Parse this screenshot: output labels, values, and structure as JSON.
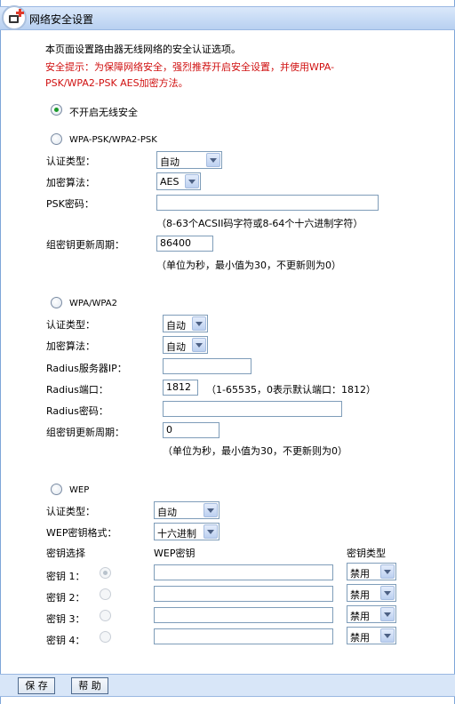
{
  "header": {
    "title": "网络安全设置"
  },
  "intro": "本页面设置路由器无线网络的安全认证选项。",
  "warning": {
    "line1": "安全提示：为保障网络安全，强烈推荐开启安全设置，并使用WPA-",
    "line2": "PSK/WPA2-PSK AES加密方法。"
  },
  "no_security": {
    "label": "不开启无线安全",
    "selected": true
  },
  "wpa_psk": {
    "title": "WPA-PSK/WPA2-PSK",
    "auth_label": "认证类型：",
    "auth_value": "自动",
    "enc_label": "加密算法：",
    "enc_value": "AES",
    "psk_label": "PSK密码：",
    "psk_value": "",
    "psk_hint": "（8-63个ACSII码字符或8-64个十六进制字符）",
    "period_label": "组密钥更新周期：",
    "period_value": "86400",
    "period_hint": "（单位为秒，最小值为30，不更新则为0）"
  },
  "wpa": {
    "title": "WPA/WPA2",
    "auth_label": "认证类型：",
    "auth_value": "自动",
    "enc_label": "加密算法：",
    "enc_value": "自动",
    "radius_ip_label": "Radius服务器IP：",
    "radius_ip_value": "",
    "radius_port_label": "Radius端口：",
    "radius_port_value": "1812",
    "radius_port_hint": "（1-65535，0表示默认端口：1812）",
    "radius_pwd_label": "Radius密码：",
    "radius_pwd_value": "",
    "period_label": "组密钥更新周期：",
    "period_value": "0",
    "period_hint": "（单位为秒，最小值为30，不更新则为0）"
  },
  "wep": {
    "title": "WEP",
    "auth_label": "认证类型：",
    "auth_value": "自动",
    "format_label": "WEP密钥格式：",
    "format_value": "十六进制",
    "col_select": "密钥选择",
    "col_key": "WEP密钥",
    "col_type": "密钥类型",
    "keys": [
      {
        "label": "密钥 1：",
        "value": "",
        "type": "禁用"
      },
      {
        "label": "密钥 2：",
        "value": "",
        "type": "禁用"
      },
      {
        "label": "密钥 3：",
        "value": "",
        "type": "禁用"
      },
      {
        "label": "密钥 4：",
        "value": "",
        "type": "禁用"
      }
    ]
  },
  "footer": {
    "save": "保 存",
    "help": "帮 助"
  },
  "colors": {
    "warning": "#d01010",
    "titlebar": "#c7dbf5",
    "radio_selected": "#1a9a2a"
  }
}
